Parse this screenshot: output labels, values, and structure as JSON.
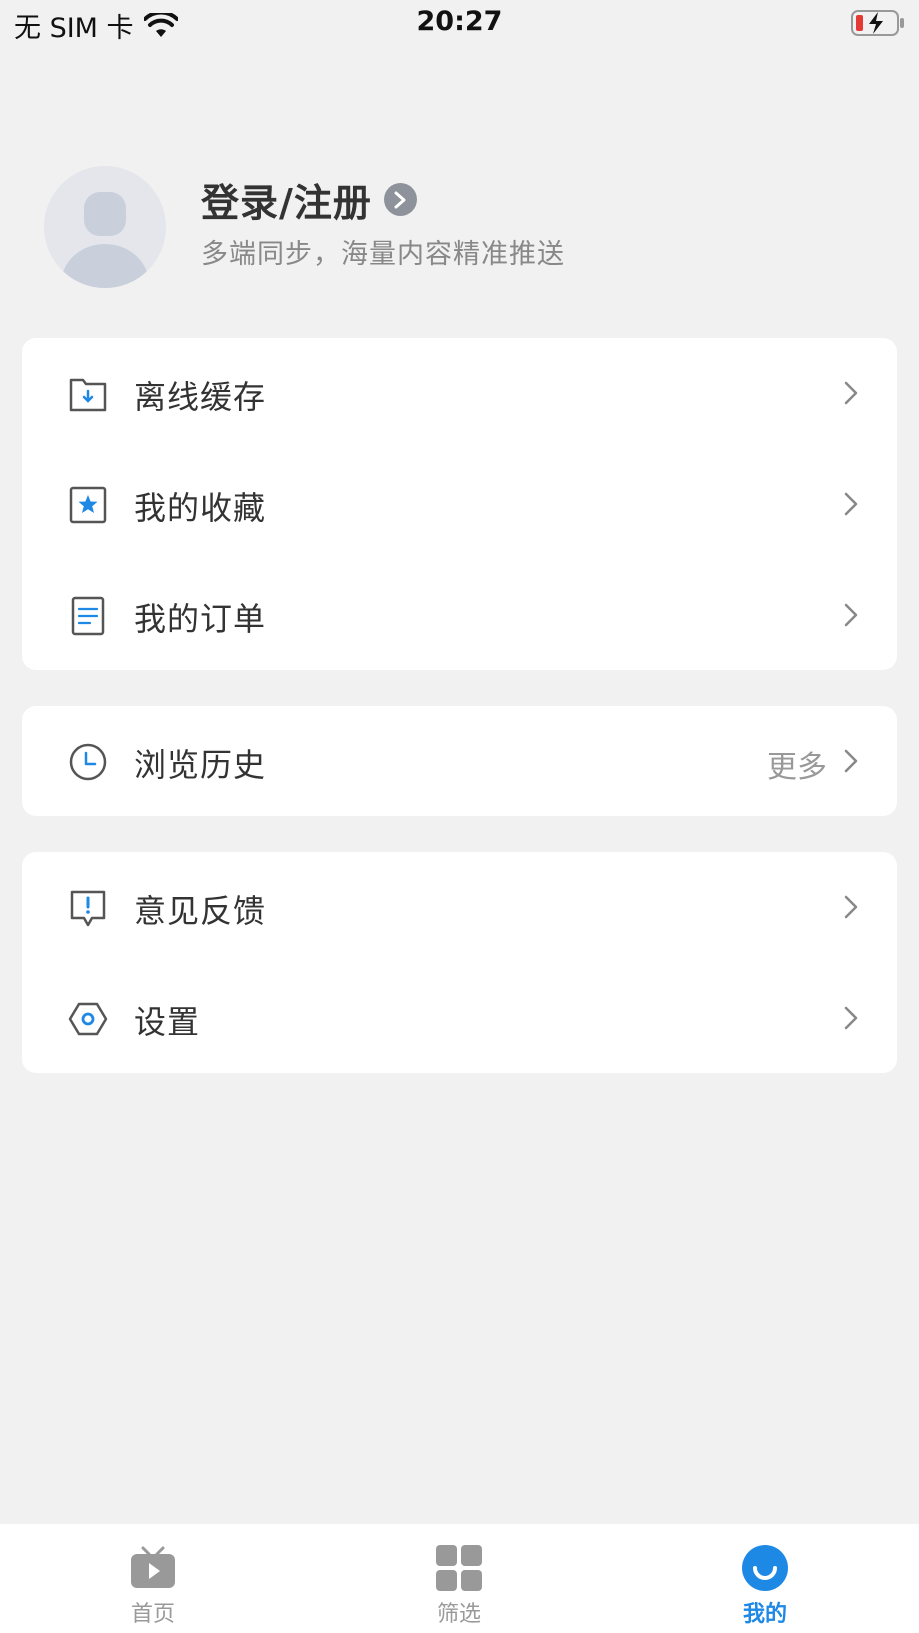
{
  "status_bar": {
    "carrier": "无 SIM 卡",
    "time": "20:27"
  },
  "profile": {
    "login_title": "登录/注册",
    "subtitle": "多端同步，海量内容精准推送"
  },
  "menu_group_1": {
    "items": [
      {
        "label": "离线缓存",
        "icon": "offline-download-folder-icon"
      },
      {
        "label": "我的收藏",
        "icon": "favorites-star-icon"
      },
      {
        "label": "我的订单",
        "icon": "orders-document-icon"
      }
    ]
  },
  "menu_group_2": {
    "items": [
      {
        "label": "浏览历史",
        "icon": "history-clock-icon",
        "more": "更多"
      }
    ]
  },
  "menu_group_3": {
    "items": [
      {
        "label": "意见反馈",
        "icon": "feedback-exclamation-icon"
      },
      {
        "label": "设置",
        "icon": "settings-hexagon-icon"
      }
    ]
  },
  "tabbar": {
    "tabs": [
      {
        "label": "首页",
        "icon": "tv-play-icon",
        "active": false
      },
      {
        "label": "筛选",
        "icon": "grid-filter-icon",
        "active": false
      },
      {
        "label": "我的",
        "icon": "smile-profile-icon",
        "active": true
      }
    ]
  },
  "colors": {
    "accent": "#1e88e5",
    "background": "#f1f1f1",
    "card": "#ffffff"
  }
}
